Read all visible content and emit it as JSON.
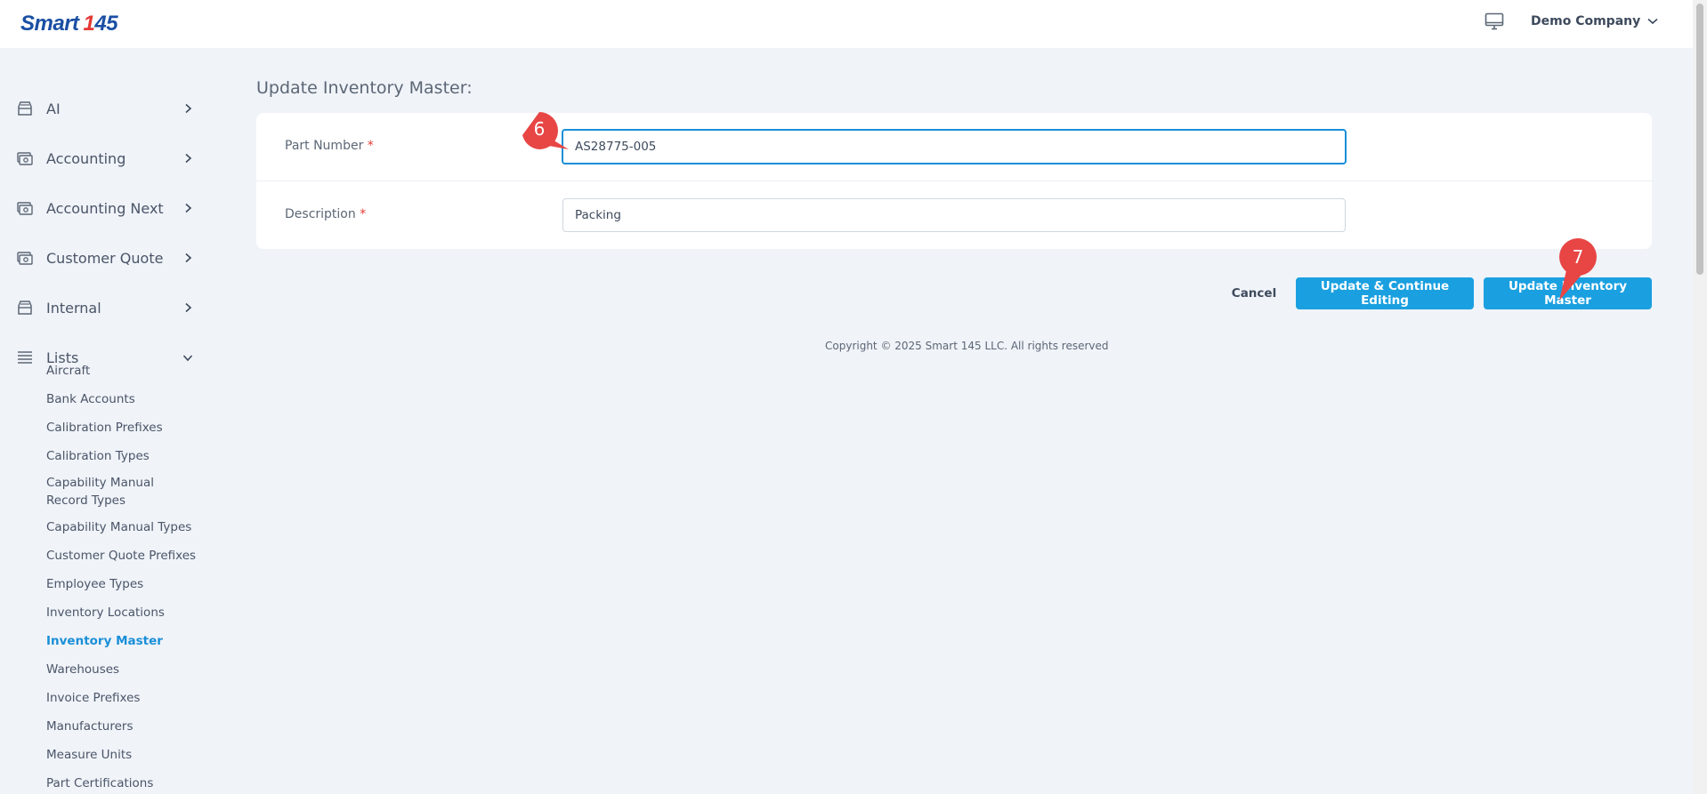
{
  "header": {
    "logo_text": "Smart",
    "logo_number_1": "1",
    "logo_number_2": "45",
    "company_name": "Demo Company"
  },
  "sidebar": {
    "items": [
      {
        "label": "AI",
        "icon": "archive-icon"
      },
      {
        "label": "Accounting",
        "icon": "money-icon"
      },
      {
        "label": "Accounting Next",
        "icon": "money-icon"
      },
      {
        "label": "Customer Quote",
        "icon": "money-icon"
      },
      {
        "label": "Internal",
        "icon": "archive-icon"
      },
      {
        "label": "Lists",
        "icon": "list-icon"
      }
    ],
    "sub_items": [
      "Aircraft",
      "Bank Accounts",
      "Calibration Prefixes",
      "Calibration Types",
      "Capability Manual",
      "Record Types",
      "Capability Manual Types",
      "Customer Quote Prefixes",
      "Employee Types",
      "Inventory Locations",
      "Inventory Master",
      "Warehouses",
      "Invoice Prefixes",
      "Manufacturers",
      "Measure Units",
      "Part Certifications"
    ],
    "active_sub_item": "Inventory Master"
  },
  "main": {
    "title": "Update Inventory Master:",
    "fields": [
      {
        "label": "Part Number",
        "required_mark": "*",
        "value": "AS28775-005"
      },
      {
        "label": "Description",
        "required_mark": "*",
        "value": "Packing"
      }
    ],
    "buttons": {
      "cancel": "Cancel",
      "continue": "Update & Continue Editing",
      "update": "Update Inventory Master"
    },
    "copyright": "Copyright © 2025 Smart 145 LLC. All rights reserved"
  },
  "markers": [
    "6",
    "7"
  ],
  "colors": {
    "accent": "#1aa0e0",
    "active_link": "#1a8fd8",
    "required": "#e53935",
    "marker": "#e84545",
    "background": "#f0f3f8"
  }
}
